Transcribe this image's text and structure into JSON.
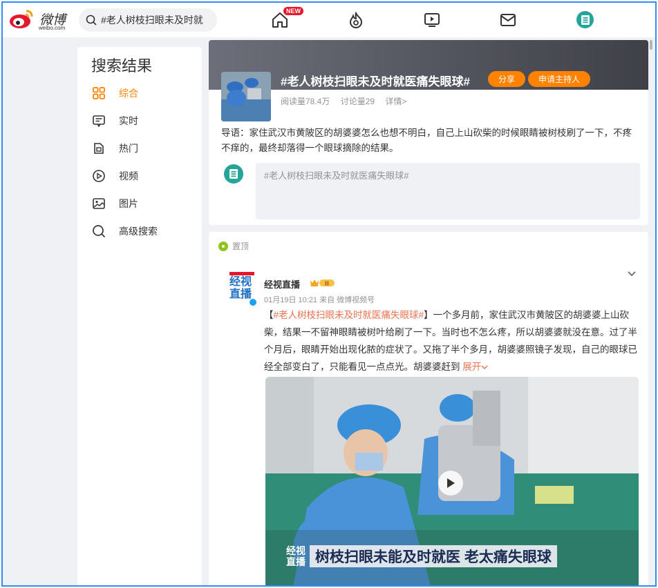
{
  "header": {
    "logo_text": "微博",
    "logo_url": "weibo.com",
    "search_value": "#老人树枝扫眼未及时就",
    "new_badge": "NEW",
    "nav_icons": [
      "home-icon",
      "hot-fire-icon",
      "video-play-icon",
      "mail-icon",
      "profile-avatar-icon"
    ]
  },
  "sidebar": {
    "title": "搜索结果",
    "items": [
      {
        "label": "综合",
        "icon": "grid-icon",
        "active": true
      },
      {
        "label": "实时",
        "icon": "realtime-icon",
        "active": false
      },
      {
        "label": "热门",
        "icon": "hot-doc-icon",
        "active": false
      },
      {
        "label": "视频",
        "icon": "video-icon",
        "active": false
      },
      {
        "label": "图片",
        "icon": "image-icon",
        "active": false
      },
      {
        "label": "高级搜索",
        "icon": "advanced-search-icon",
        "active": false
      }
    ]
  },
  "topic": {
    "title": "#老人树枝扫眼未及时就医痛失眼球#",
    "share_label": "分享",
    "host_label": "申请主持人",
    "reads": "阅读量78.4万",
    "discussions": "讨论量29",
    "details": "详情>",
    "intro": "导语：家住武汉市黄陂区的胡婆婆怎么也想不明白，自己上山砍柴的时候眼睛被树枝刷了一下，不疼不痒的，最终却落得一个眼球摘除的结果。",
    "composer_placeholder": "#老人树枝扫眼未及时就医痛失眼球#"
  },
  "post": {
    "pin_label": "置顶",
    "author": "经视直播",
    "avatar_text_top": "经视",
    "avatar_text_bottom": "直播",
    "meta": "01月19日 10:21  来自 微博视频号",
    "body_prefix": "【",
    "body_hashtag": "#老人树枝扫眼未及时就医痛失眼球#",
    "body_text": "】一个多月前，家住武汉市黄陂区的胡婆婆上山砍柴，结果一不留神眼睛被树叶给刷了一下。当时也不怎么疼，所以胡婆婆就没在意。过了半个月后，眼睛开始出现化脓的症状了。又拖了半个多月，胡婆婆照镜子发现，自己的眼球已经全部变白了，只能看见一点点光。胡婆婆赶到",
    "expand_label": "展开",
    "video_caption": "树枝扫眼未能及时就医 老太痛失眼球",
    "video_logo_top": "经视",
    "video_logo_bottom": "直播"
  },
  "colors": {
    "accent": "#ff8200",
    "hashtag": "#eb7350",
    "frame": "#2f8cf0"
  }
}
